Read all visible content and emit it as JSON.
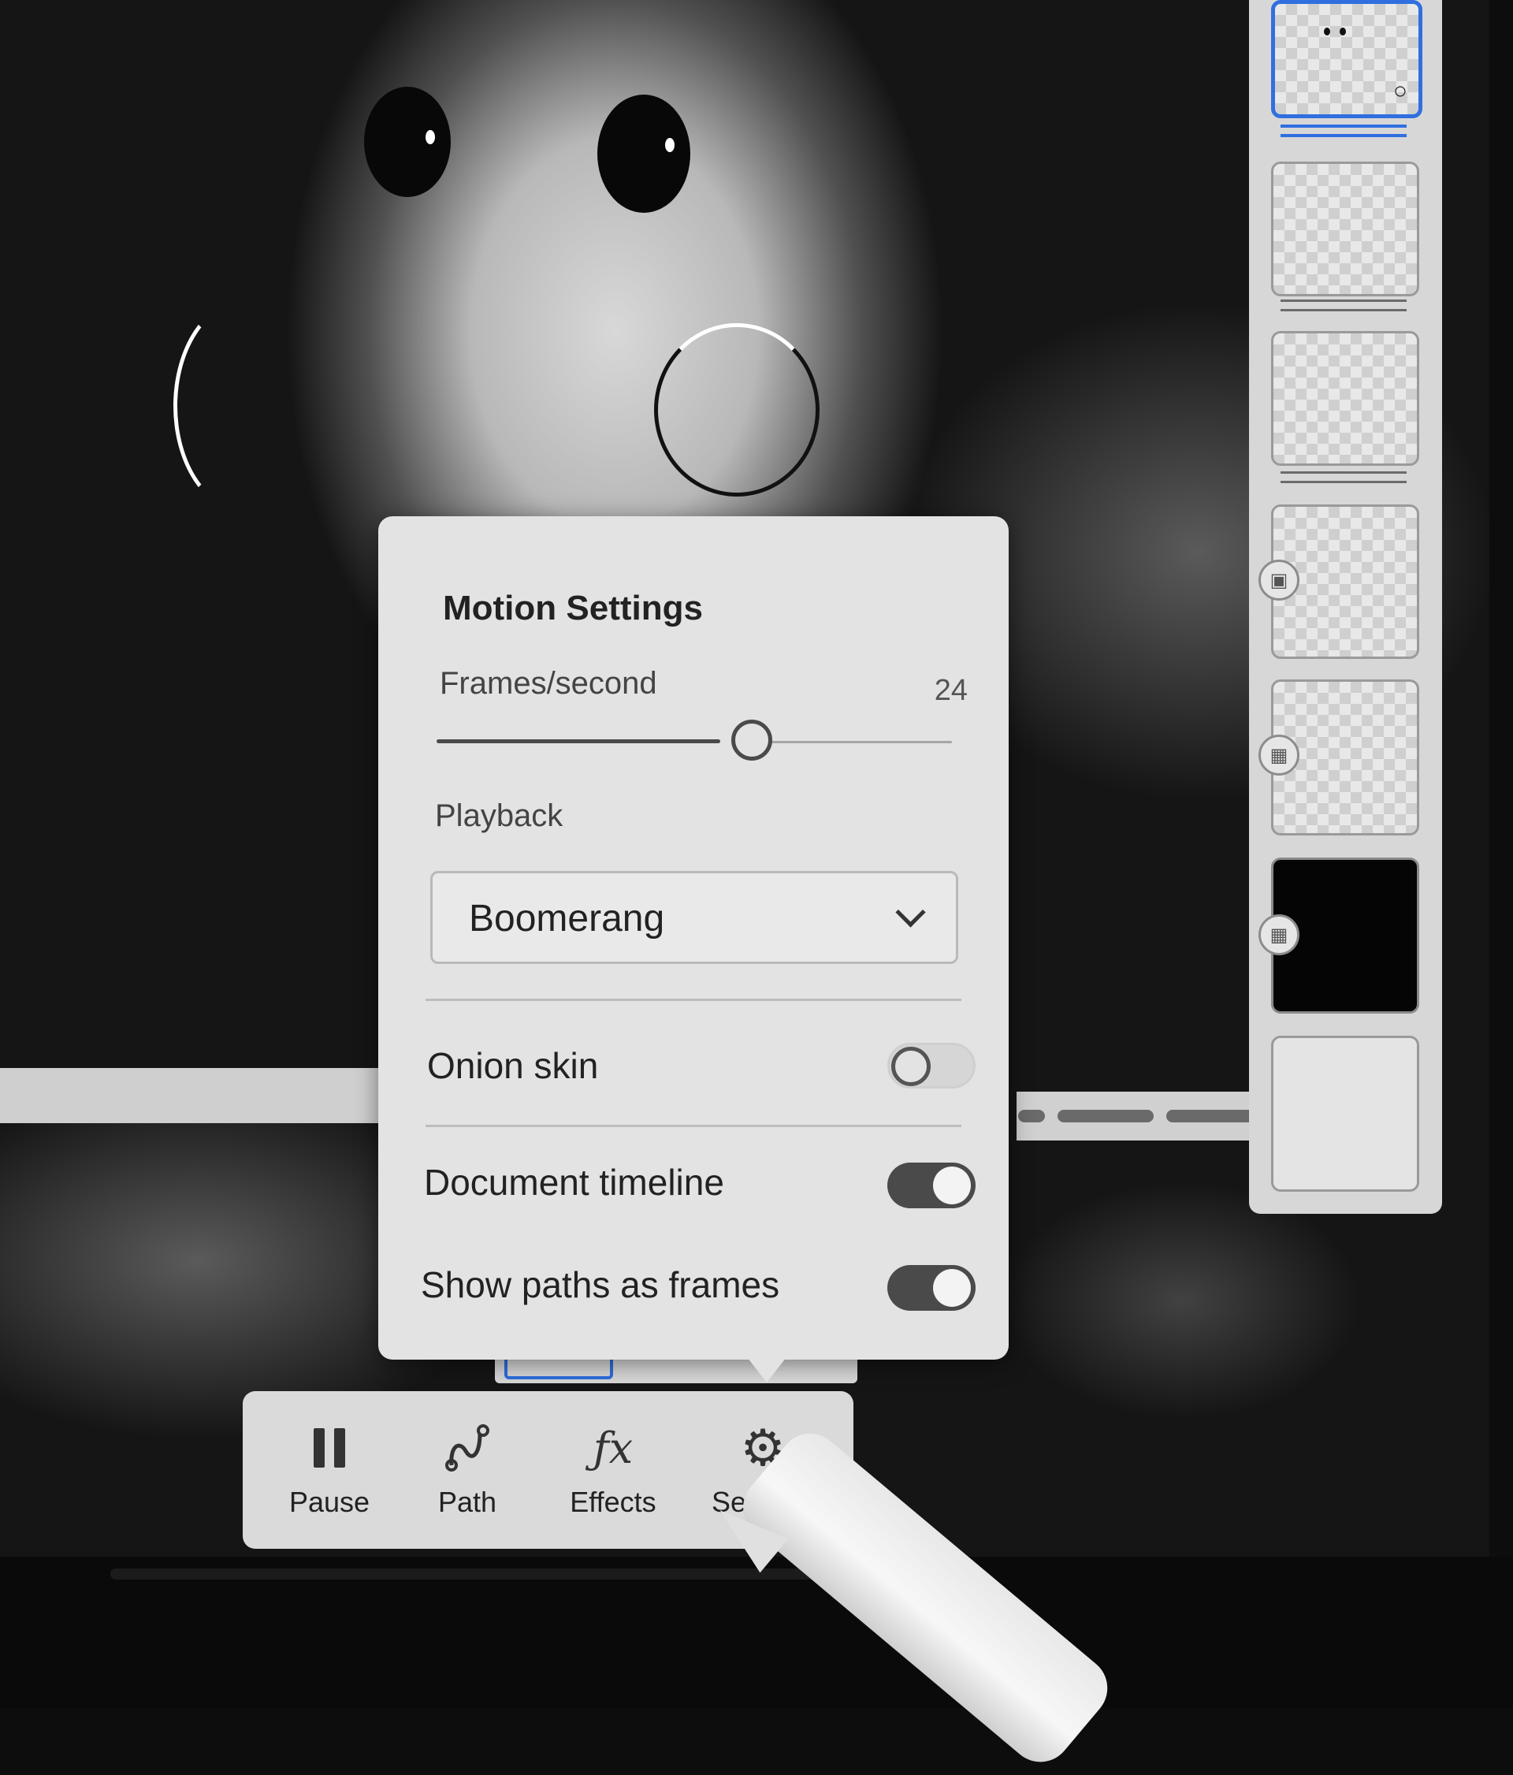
{
  "motion_settings": {
    "title": "Motion Settings",
    "fps_label": "Frames/second",
    "fps_value": "24",
    "fps_slider_fraction": 0.55,
    "playback_label": "Playback",
    "playback_value": "Boomerang",
    "onion_skin_label": "Onion skin",
    "onion_skin_on": false,
    "document_timeline_label": "Document timeline",
    "document_timeline_on": true,
    "show_paths_label": "Show paths as frames",
    "show_paths_on": true
  },
  "toolbar": {
    "items": [
      {
        "label": "Pause",
        "icon": "pause-icon"
      },
      {
        "label": "Path",
        "icon": "path-icon"
      },
      {
        "label": "Effects",
        "icon": "fx-icon"
      },
      {
        "label": "Settings",
        "icon": "gear-icon"
      }
    ]
  },
  "frames_panel": {
    "selected_index": 0,
    "frame_count": 7
  },
  "colors": {
    "accent": "#2f6fe0",
    "popover_bg": "#e3e3e3",
    "toggle_on": "#4a4a4a"
  }
}
